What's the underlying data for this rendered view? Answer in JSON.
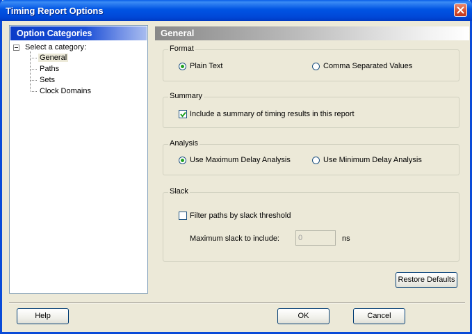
{
  "window": {
    "title": "Timing Report Options"
  },
  "categories": {
    "header": "Option Categories",
    "root": "Select a category:",
    "items": [
      "General",
      "Paths",
      "Sets",
      "Clock Domains"
    ],
    "selected": "General"
  },
  "panel": {
    "header": "General",
    "format": {
      "legend": "Format",
      "options": [
        "Plain Text",
        "Comma Separated Values"
      ],
      "selected": "Plain Text"
    },
    "summary": {
      "legend": "Summary",
      "checkbox_label": "Include a summary of timing results in this report",
      "checked": true
    },
    "analysis": {
      "legend": "Analysis",
      "options": [
        "Use Maximum Delay Analysis",
        "Use Minimum Delay Analysis"
      ],
      "selected": "Use Maximum Delay Analysis"
    },
    "slack": {
      "legend": "Slack",
      "checkbox_label": "Filter paths by slack threshold",
      "checked": false,
      "max_label": "Maximum slack to include:",
      "max_value": "0",
      "unit": "ns"
    },
    "restore_label": "Restore Defaults"
  },
  "footer": {
    "help": "Help",
    "ok": "OK",
    "cancel": "Cancel"
  },
  "colors": {
    "title_bar": "#0054e3",
    "close_button": "#d24f30",
    "category_header": "#0a3cc8",
    "dialog_bg": "#ece9d8"
  }
}
